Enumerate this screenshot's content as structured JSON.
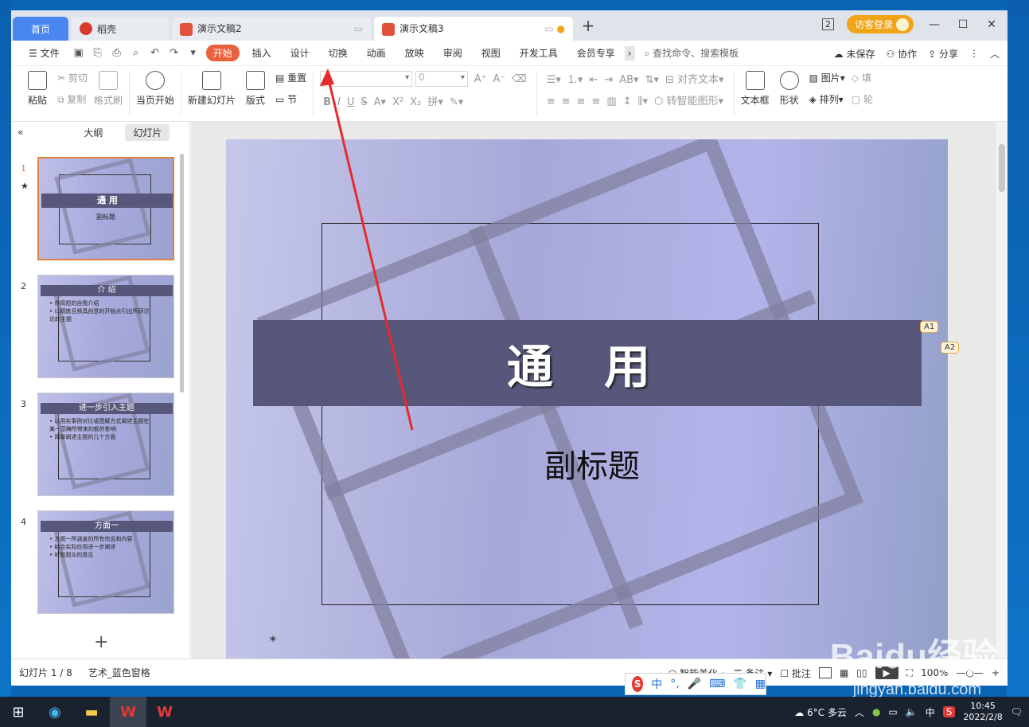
{
  "tabs": [
    {
      "label": "首页"
    },
    {
      "label": "稻壳"
    },
    {
      "label": "演示文稿2"
    },
    {
      "label": "演示文稿3"
    }
  ],
  "titlebar": {
    "badge": "2",
    "login": "访客登录"
  },
  "menu": {
    "file": "文件",
    "items": [
      "开始",
      "插入",
      "设计",
      "切换",
      "动画",
      "放映",
      "审阅",
      "视图",
      "开发工具",
      "会员专享"
    ],
    "search": "查找命令、搜索模板",
    "unsaved": "未保存",
    "collab": "协作",
    "share": "分享"
  },
  "ribbon": {
    "paste": "粘贴",
    "cut": "剪切",
    "copy": "复制",
    "format_painter": "格式刷",
    "from_current": "当页开始",
    "new_slide": "新建幻灯片",
    "layout": "版式",
    "reset": "重置",
    "section": "节",
    "font_size": "0",
    "align_text": "对齐文本",
    "smart_shape": "转智能图形",
    "textbox": "文本框",
    "shape": "形状",
    "picture": "图片",
    "arrange": "排列",
    "fill": "填",
    "outline": "轮"
  },
  "sidebar": {
    "outline_tab": "大纲",
    "slides_tab": "幻灯片",
    "thumbs": [
      {
        "num": "1",
        "title": "通 用",
        "sub": "副标题"
      },
      {
        "num": "2",
        "title": "介 绍",
        "lines": [
          "• 作简短的自我介绍",
          "• 以精炼且频具创意的开始点引出所研讨",
          "  论的主题"
        ]
      },
      {
        "num": "3",
        "title": "进一步引入主题",
        "lines": [
          "• 以用实事例对比或图解方式阐述主题在",
          "  某一范畴所带来的额外影响",
          "• 简单阐述主题的几个方面"
        ]
      },
      {
        "num": "4",
        "title": "方面一",
        "lines": [
          "• 方面一所涵盖的所有信息和内容",
          "• 结合实际应用进一步阐述",
          "• 听取观众的意见"
        ]
      }
    ]
  },
  "slide": {
    "title": "通 用",
    "subtitle": "副标题",
    "star": "*",
    "anno1": "A1",
    "anno2": "A2"
  },
  "status": {
    "slide_count": "幻灯片 1 / 8",
    "theme": "艺术_蓝色窗格",
    "beautify": "智能美化",
    "notes": "备注",
    "comments": "批注",
    "zoom": "100%"
  },
  "ime": {
    "lang": "中"
  },
  "tray": {
    "weather": "6°C 多云",
    "lang": "中",
    "time": "10:45",
    "date": "2022/2/8"
  },
  "watermark": {
    "brand": "Baidu经验",
    "url": "jingyan.baidu.com"
  }
}
